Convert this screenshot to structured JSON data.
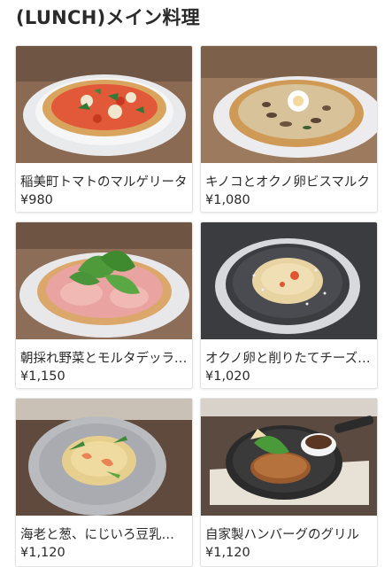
{
  "page": {
    "title": "(LUNCH)メイン料理"
  },
  "menu": {
    "items": [
      {
        "name": "稲美町トマトのマルゲリータ",
        "price": "¥980",
        "icon": "margherita-pizza-photo"
      },
      {
        "name": "キノコとオクノ卵ビスマルク",
        "price": "¥1,080",
        "icon": "bismarck-pizza-photo"
      },
      {
        "name": "朝採れ野菜とモルタデッラハム…",
        "price": "¥1,150",
        "icon": "vegetable-ham-pizza-photo"
      },
      {
        "name": "オクノ卵と削りたてチーズ…",
        "price": "¥1,020",
        "icon": "carbonara-pasta-photo"
      },
      {
        "name": "海老と葱、にじいろ豆乳…",
        "price": "¥1,120",
        "icon": "shrimp-pasta-photo"
      },
      {
        "name": "自家製ハンバーグのグリル",
        "price": "¥1,120",
        "icon": "hamburg-steak-photo"
      }
    ]
  }
}
